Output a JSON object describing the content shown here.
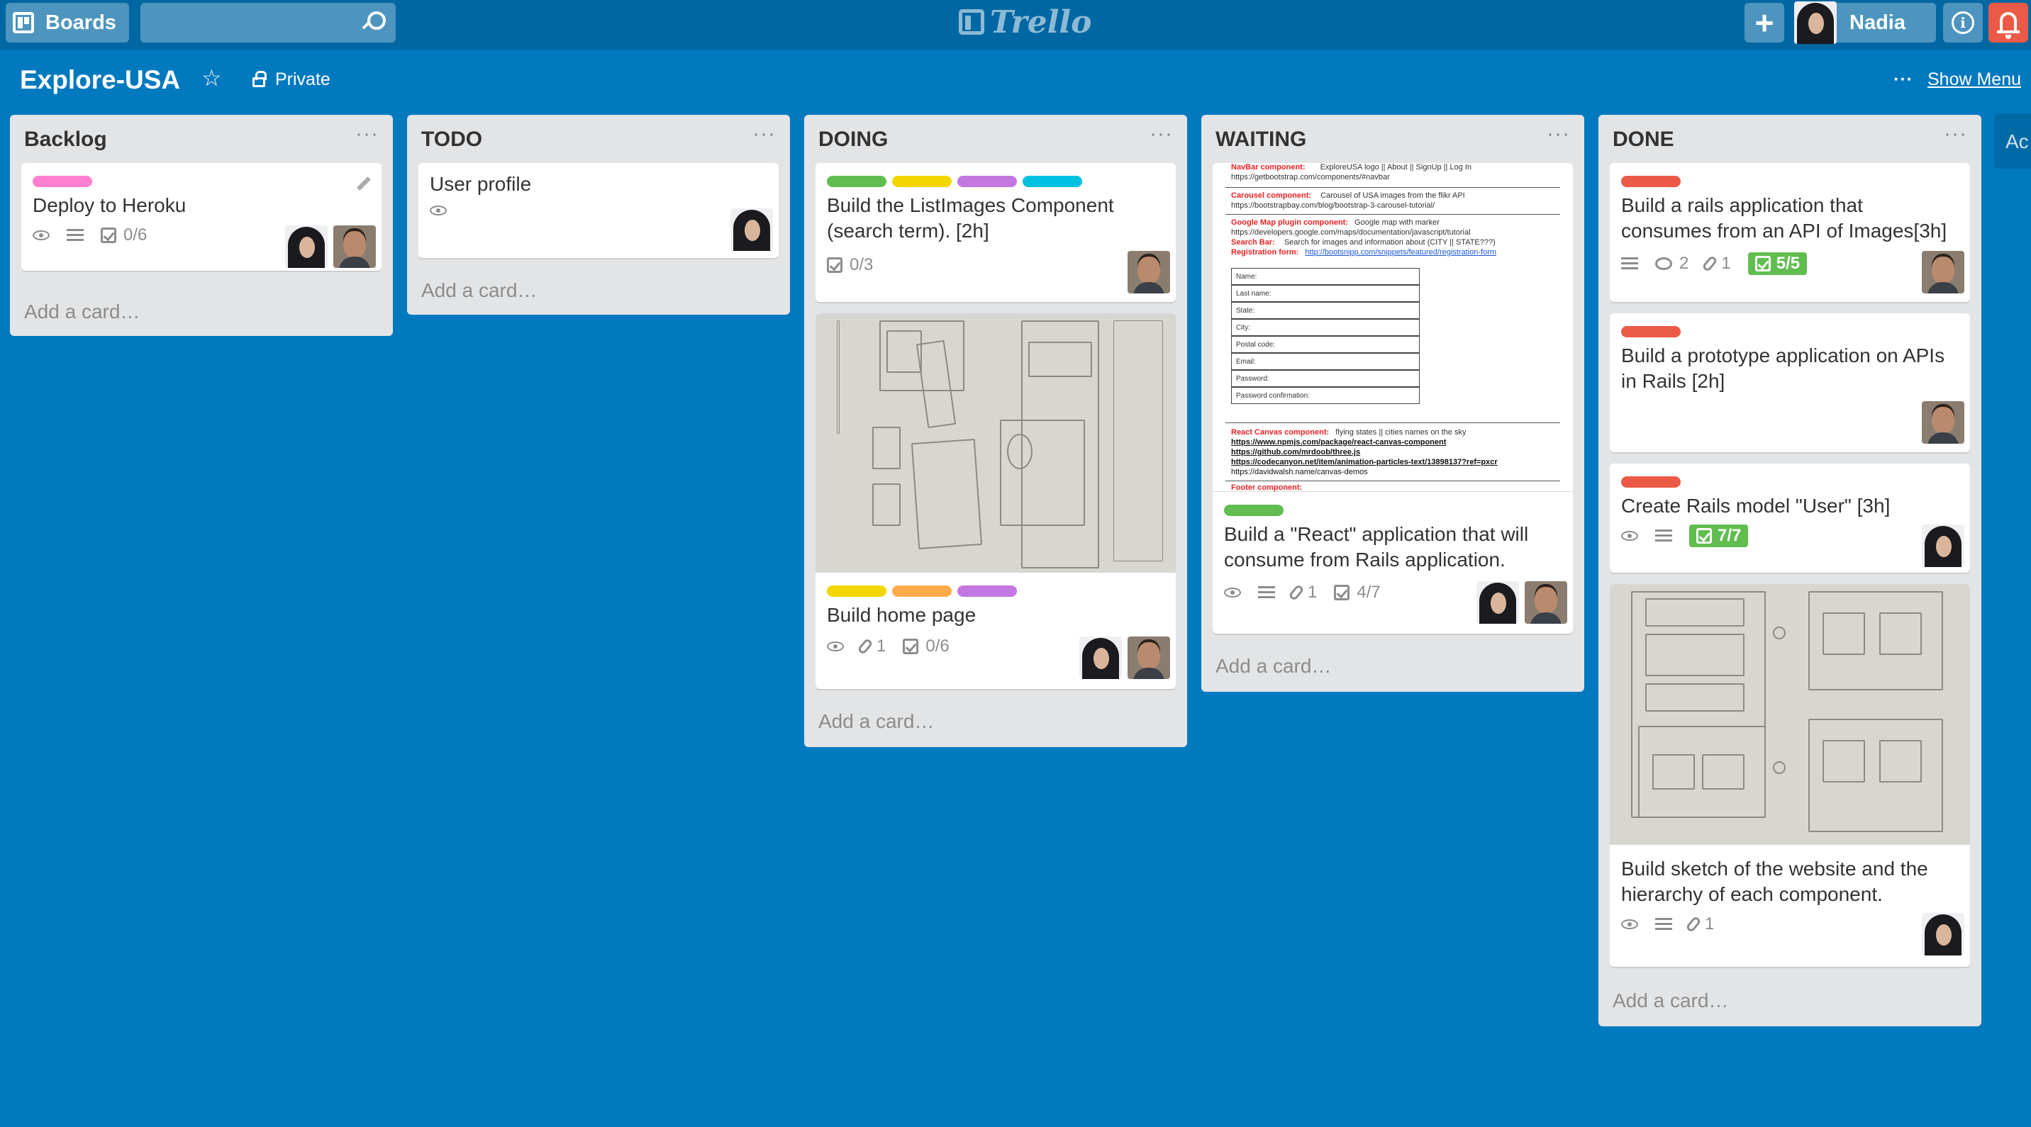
{
  "topbar": {
    "boards_label": "Boards",
    "search_placeholder": "",
    "logo_text": "Trello",
    "add_label": "+",
    "user_name": "Nadia",
    "info_label": "i"
  },
  "board": {
    "title": "Explore-USA",
    "visibility": "Private",
    "show_menu_dots": "···",
    "show_menu_label": "Show Menu"
  },
  "colors": {
    "board_bg": "#0079bf",
    "topbar_bg": "#0067a3",
    "notification_red": "#eb5a46",
    "label_green": "#61bd4f",
    "label_yellow": "#f2d600",
    "label_orange": "#ffab4a",
    "label_red": "#eb5a46",
    "label_purple": "#c377e0",
    "label_sky": "#00c2e0",
    "label_pink": "#ff80ce"
  },
  "list_menu": "···",
  "add_card": "Add a card…",
  "lists": [
    {
      "title": "Backlog",
      "cards": [
        {
          "title": "Deploy to Heroku",
          "labels": [
            "pink"
          ],
          "checklist": "0/6",
          "members": [
            "Nadia",
            "teammate"
          ]
        }
      ]
    },
    {
      "title": "TODO",
      "cards": [
        {
          "title": "User profile",
          "watching": true,
          "members": [
            "Nadia"
          ]
        }
      ]
    },
    {
      "title": "DOING",
      "cards": [
        {
          "title": "Build the ListImages Component (search term). [2h]",
          "labels": [
            "green",
            "yellow",
            "purple",
            "sky"
          ],
          "checklist": "0/3",
          "members": [
            "teammate"
          ]
        },
        {
          "title": "Build home page",
          "labels": [
            "yellow",
            "orange",
            "purple"
          ],
          "cover": "hand-drawn wireframe sketch",
          "attachments": "1",
          "checklist": "0/6",
          "members": [
            "Nadia",
            "teammate"
          ]
        }
      ]
    },
    {
      "title": "WAITING",
      "cards": [
        {
          "title": "Build a \"React\" application that will consume from Rails application.",
          "labels": [
            "green"
          ],
          "cover": "component spec document",
          "attachments": "1",
          "checklist": "4/7",
          "members": [
            "Nadia",
            "teammate"
          ]
        }
      ]
    },
    {
      "title": "DONE",
      "cards": [
        {
          "title": "Build a rails application that consumes from an API of Images[3h]",
          "labels": [
            "red"
          ],
          "comments": "2",
          "attachments": "1",
          "checklist": "5/5",
          "members": [
            "teammate"
          ]
        },
        {
          "title": "Build a prototype application on APIs in Rails [2h]",
          "labels": [
            "red"
          ],
          "members": [
            "teammate"
          ]
        },
        {
          "title": "Create Rails model \"User\" [3h]",
          "labels": [
            "red"
          ],
          "checklist": "7/7",
          "members": [
            "Nadia"
          ]
        },
        {
          "title": "Build sketch of the website and the hierarchy of each component.",
          "cover": "hand-drawn wireframe sketch",
          "attachments": "1",
          "members": [
            "Nadia"
          ]
        }
      ]
    }
  ],
  "doc_cover": {
    "lines": [
      "NavBar component:",
      "ExploreUSA logo || About || SignUp || Log In",
      "https://getbootstrap.com/components/#navbar",
      "Carousel component:",
      "Carousel of USA images from the flikr API",
      "https://bootstrapbay.com/blog/bootstrap-3-carousel-tutorial/",
      "Google Map plugin component:",
      "Google map with marker",
      "https://developers.google.com/maps/documentation/javascript/tutorial",
      "Search Bar:",
      "Search for images and information about (CITY || STATE???)",
      "Registration form:",
      "http://bootsnipp.com/snippets/featured/registration-form",
      "React Canvas component:",
      "flying states || cities names on the sky",
      "https://www.npmjs.com/package/react-canvas-component",
      "https://github.com/mrdoob/three.js",
      "https://codecanyon.net/item/animation-particles-text/13898137?ref=pxcr",
      "https://davidwalsh.name/canvas-demos",
      "Footer component:"
    ],
    "form_fields": [
      "Name:",
      "Last name:",
      "State:",
      "City:",
      "Postal code:",
      "Email:",
      "Password:",
      "Password confirmation:"
    ]
  },
  "extra_list_text": "Ac"
}
